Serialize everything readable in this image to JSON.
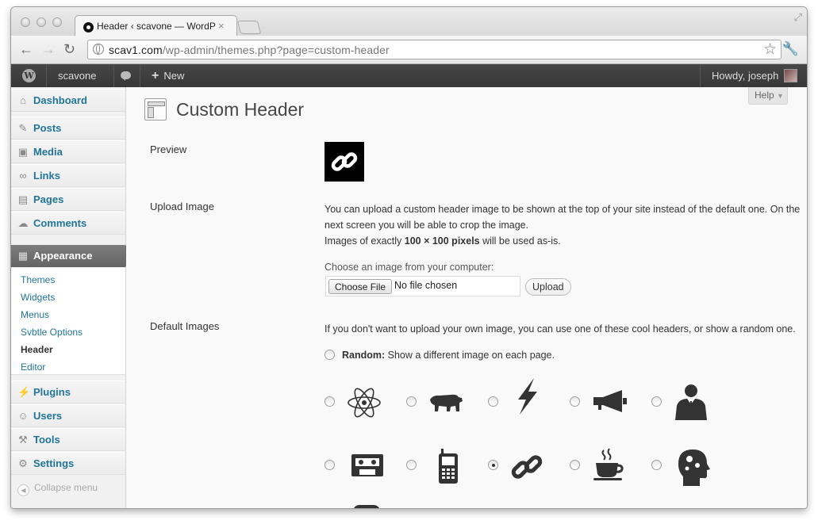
{
  "browser": {
    "tab_title": "Header ‹ scavone — WordPress",
    "close_glyph": "×",
    "url_host": "scav1.com",
    "url_path": "/wp-admin/themes.php?page=custom-header"
  },
  "adminbar": {
    "site_name": "scavone",
    "new_label": "New",
    "new_glyph": "+",
    "greeting": "Howdy, joseph"
  },
  "sidebar": {
    "items": [
      {
        "label": "Dashboard",
        "icon": "dashboard-icon"
      },
      {
        "label": "Posts",
        "icon": "pin-icon"
      },
      {
        "label": "Media",
        "icon": "media-icon"
      },
      {
        "label": "Links",
        "icon": "link-icon"
      },
      {
        "label": "Pages",
        "icon": "pages-icon"
      },
      {
        "label": "Comments",
        "icon": "comment-icon"
      },
      {
        "label": "Appearance",
        "icon": "appearance-icon"
      },
      {
        "label": "Plugins",
        "icon": "plug-icon"
      },
      {
        "label": "Users",
        "icon": "users-icon"
      },
      {
        "label": "Tools",
        "icon": "tools-icon"
      },
      {
        "label": "Settings",
        "icon": "settings-icon"
      }
    ],
    "submenu": [
      "Themes",
      "Widgets",
      "Menus",
      "Svbtle Options",
      "Header",
      "Editor"
    ],
    "current_sub": "Header",
    "collapse_label": "Collapse menu"
  },
  "main": {
    "title": "Custom Header",
    "help_label": "Help",
    "preview_label": "Preview",
    "upload_label": "Upload Image",
    "upload_text_1": "You can upload a custom header image to be shown at the top of your site instead of the default one. On the",
    "upload_text_2": "next screen you will be able to crop the image.",
    "upload_text_3a": "Images of exactly ",
    "upload_text_3b": "100 × 100 pixels",
    "upload_text_3c": " will be used as-is.",
    "choose_label": "Choose an image from your computer:",
    "choose_button": "Choose File",
    "no_file": "No file chosen",
    "upload_button": "Upload",
    "default_label": "Default Images",
    "default_text": "If you don't want to upload your own image, you can use one of these cool headers, or show a random one.",
    "random_bold": "Random:",
    "random_text": " Show a different image on each page.",
    "images": [
      "atom",
      "bear",
      "lightning",
      "megaphone",
      "businessman",
      "cassette",
      "cellphone",
      "chain-link",
      "coffee-cup",
      "head-gears"
    ],
    "selected_image": "chain-link"
  },
  "colors": {
    "link": "#21759b",
    "adminbar": "#3f3f3f",
    "appearance_active": "#707070"
  }
}
